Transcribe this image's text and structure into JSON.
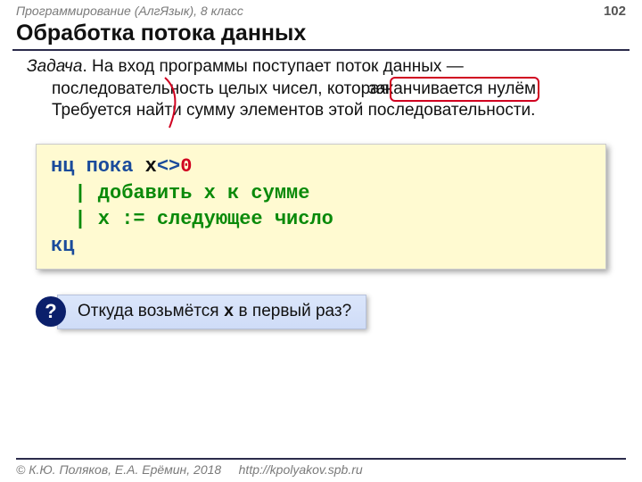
{
  "header": {
    "course": "Программирование (АлгЯзык), 8 класс",
    "page": "102"
  },
  "title": "Обработка потока данных",
  "task": {
    "label": "Задача",
    "before": ". На вход программы поступает поток данных — последовательность целых чисел, которая ",
    "highlight": "заканчивается нулём",
    "after": ". Требуется найти сумму элементов этой последовательности."
  },
  "code": {
    "l1_kw": "нц пока",
    "l1_var": " x",
    "l1_op": "<>",
    "l1_zero": "0",
    "l2": "  | добавить x к сумме",
    "l3": "  | x := следующее число",
    "l4_kw": "кц"
  },
  "question": {
    "mark": "?",
    "before": " Откуда возьмётся ",
    "mono": "x",
    "after": "  в первый раз?"
  },
  "footer": {
    "copyright": "© К.Ю. Поляков, Е.А. Ерёмин, 2018",
    "url": "http://kpolyakov.spb.ru"
  }
}
